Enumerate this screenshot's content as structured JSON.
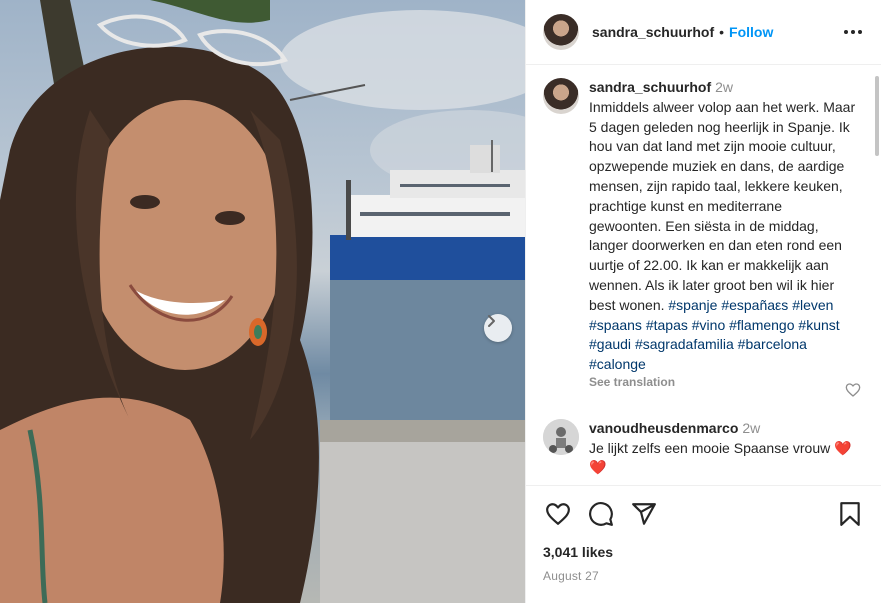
{
  "post": {
    "username": "sandra_schuurhof",
    "follow_label": "Follow",
    "separator": "•"
  },
  "caption": {
    "username": "sandra_schuurhof",
    "time": "2w",
    "text": "Inmiddels alweer volop aan het werk. Maar 5 dagen geleden nog heerlijk in Spanje. Ik hou van dat land met zijn mooie cultuur, opzwepende muziek en dans, de aardige mensen, zijn rapido taal, lekkere keuken, prachtige kunst en mediterrane gewoonten. Een siësta in de middag, langer doorwerken en dan eten rond een uurtje of 22.00. Ik kan er makkelijk aan wennen. Als ik later groot ben wil ik hier best wonen. ",
    "hashtags": [
      "#spanje",
      "#españaεs",
      "#leven",
      "#spaans",
      "#tapas",
      "#vino",
      "#flamengo",
      "#kunst",
      "#gaudi",
      "#sagradafamilia",
      "#barcelona",
      "#calonge"
    ],
    "see_translation": "See translation"
  },
  "comment": {
    "username": "vanoudheusdenmarco",
    "time": "2w",
    "text": "Je lijkt zelfs een mooie Spaanse vrouw",
    "emoji": "❤️❤️"
  },
  "stats": {
    "likes": "3,041 likes",
    "date": "August 27"
  },
  "icons": {
    "more": "more-options-icon",
    "like": "heart-icon",
    "comment": "comment-icon",
    "share": "share-icon",
    "save": "bookmark-icon",
    "next": "chevron-right-icon"
  },
  "colors": {
    "accent": "#0095f6",
    "hashtag": "#00376b",
    "muted": "#8e8e8e",
    "heart": "#ed4956"
  }
}
